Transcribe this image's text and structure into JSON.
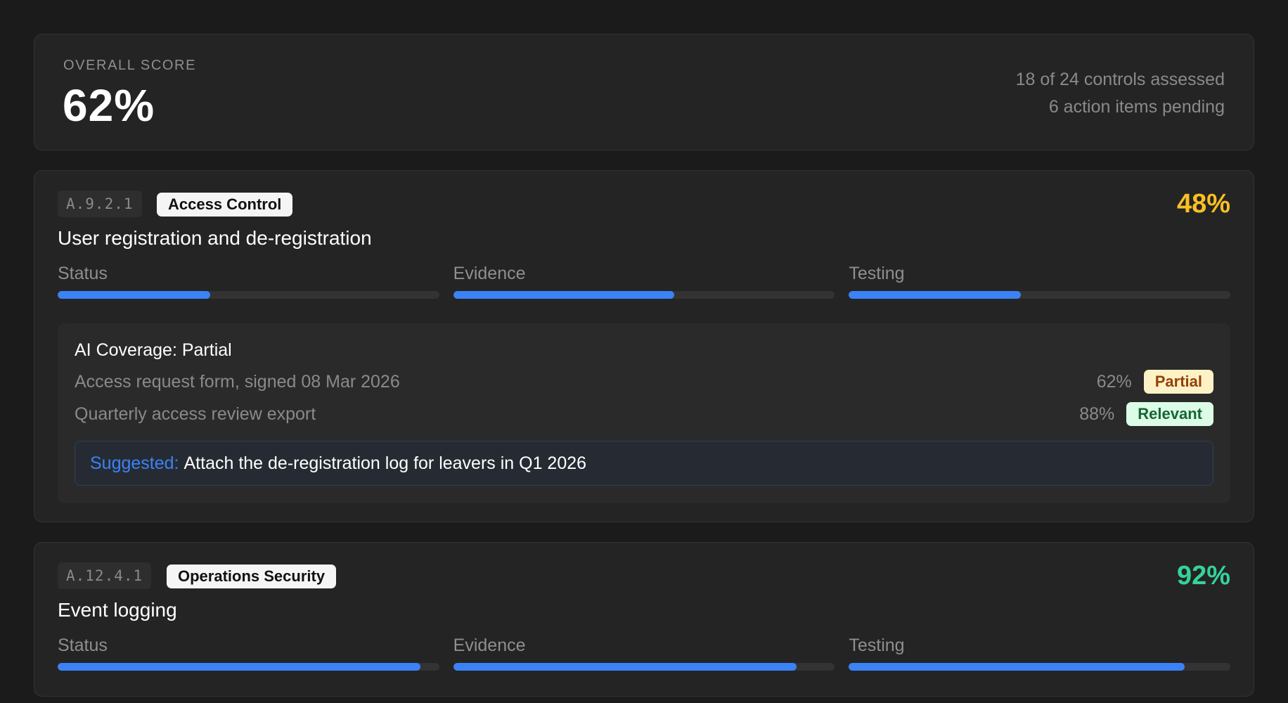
{
  "overall": {
    "label": "OVERALL SCORE",
    "score": "62%",
    "assessed": "18 of 24 controls assessed",
    "pending": "6 action items pending"
  },
  "controls": [
    {
      "id": "A.9.2.1",
      "category": "Access Control",
      "title": "User registration and de-registration",
      "score": "48%",
      "score_color": "#fbbf24",
      "metrics": [
        {
          "label": "Status",
          "progress": 0.4
        },
        {
          "label": "Evidence",
          "progress": 0.58
        },
        {
          "label": "Testing",
          "progress": 0.45
        }
      ],
      "coverage": {
        "title": "AI Coverage: Partial",
        "evidence": [
          {
            "text": "Access request form, signed 08 Mar 2026",
            "pct": "62%",
            "badge": "Partial"
          },
          {
            "text": "Quarterly access review export",
            "pct": "88%",
            "badge": "Relevant"
          }
        ],
        "suggestion_prefix": "Suggested:",
        "suggestion_text": "Attach the de-registration log for leavers in Q1 2026"
      }
    },
    {
      "id": "A.12.4.1",
      "category": "Operations Security",
      "title": "Event logging",
      "score": "92%",
      "score_color": "#34d399",
      "metrics": [
        {
          "label": "Status",
          "progress": 0.95
        },
        {
          "label": "Evidence",
          "progress": 0.9
        },
        {
          "label": "Testing",
          "progress": 0.88
        }
      ]
    }
  ],
  "colors": {
    "accent": "#3b82f6",
    "partial_bg": "#fdf2c5",
    "relevant_bg": "#dcfce7"
  }
}
